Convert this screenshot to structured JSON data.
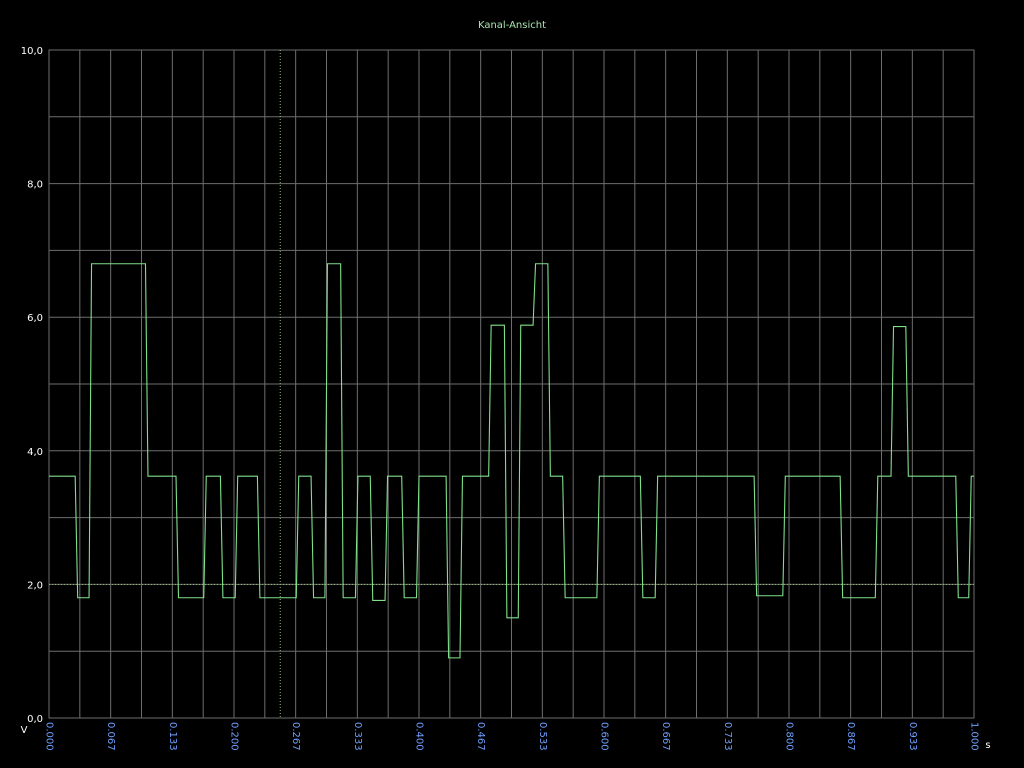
{
  "window": {
    "title": "Kanal-Ansicht"
  },
  "colors": {
    "background": "#000000",
    "grid": "#6e6e6e",
    "trace": "#7fe08a",
    "cursor": "#8fbf6a",
    "ytick": "#ffffff",
    "xtick": "#6fa0ff"
  },
  "chart_data": {
    "type": "line",
    "title": "Kanal-Ansicht",
    "xlabel": "s",
    "ylabel": "V",
    "xlim": [
      0,
      1.0
    ],
    "ylim": [
      0,
      10
    ],
    "grid": true,
    "x_ticks": [
      "0.000",
      "0.067",
      "0.133",
      "0.200",
      "0.267",
      "0.333",
      "0.400",
      "0.467",
      "0.533",
      "0.600",
      "0.667",
      "0.733",
      "0.800",
      "0.867",
      "0.933",
      "1.000"
    ],
    "y_ticks": [
      "0,0",
      "2,0",
      "4,0",
      "6,0",
      "8,0",
      "10,0"
    ],
    "cursors": {
      "x": 0.25,
      "y": 2.0
    },
    "series": [
      {
        "values_step": [
          [
            0.0,
            3.62
          ],
          [
            0.031,
            1.8
          ],
          [
            0.046,
            6.8
          ],
          [
            0.107,
            3.62
          ],
          [
            0.14,
            1.8
          ],
          [
            0.17,
            3.62
          ],
          [
            0.188,
            1.8
          ],
          [
            0.204,
            3.62
          ],
          [
            0.228,
            1.8
          ],
          [
            0.27,
            3.62
          ],
          [
            0.286,
            1.8
          ],
          [
            0.301,
            6.8
          ],
          [
            0.318,
            1.8
          ],
          [
            0.334,
            3.62
          ],
          [
            0.35,
            1.76
          ],
          [
            0.366,
            3.62
          ],
          [
            0.384,
            1.8
          ],
          [
            0.4,
            3.62
          ],
          [
            0.432,
            0.9
          ],
          [
            0.447,
            3.62
          ],
          [
            0.478,
            5.88
          ],
          [
            0.495,
            1.5
          ],
          [
            0.51,
            5.88
          ],
          [
            0.526,
            6.8
          ],
          [
            0.542,
            3.62
          ],
          [
            0.558,
            1.8
          ],
          [
            0.595,
            3.62
          ],
          [
            0.642,
            1.8
          ],
          [
            0.658,
            3.62
          ],
          [
            0.765,
            1.83
          ],
          [
            0.796,
            3.62
          ],
          [
            0.858,
            1.8
          ],
          [
            0.896,
            3.62
          ],
          [
            0.913,
            5.86
          ],
          [
            0.929,
            3.62
          ],
          [
            0.983,
            1.8
          ],
          [
            0.997,
            3.62
          ],
          [
            1.0,
            3.62
          ]
        ]
      }
    ]
  }
}
